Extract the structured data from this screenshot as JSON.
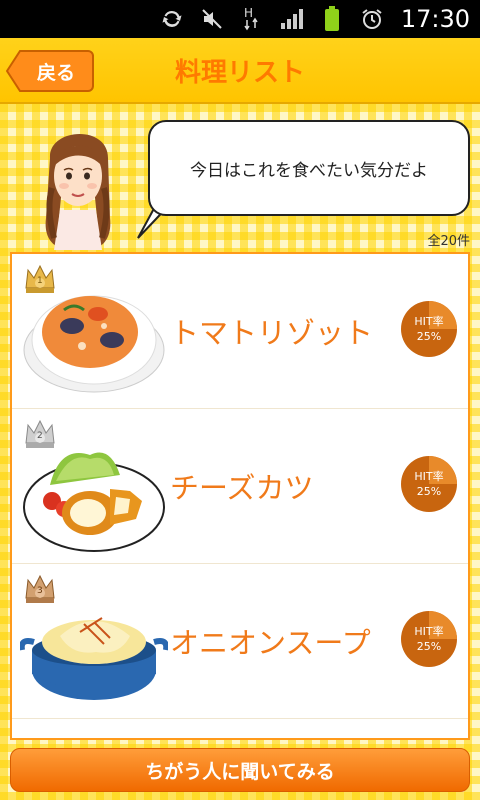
{
  "status": {
    "time": "17:30"
  },
  "header": {
    "back_label": "戻る",
    "title": "料理リスト"
  },
  "speech": {
    "text": "今日はこれを食べたい気分だよ"
  },
  "list_count": "全20件",
  "hit_label": "HIT率",
  "items": [
    {
      "rank": "1",
      "name": "トマトリゾット",
      "hit_rate": "25%",
      "hit_fraction": 0.25,
      "crown_color": "#d9a73a"
    },
    {
      "rank": "2",
      "name": "チーズカツ",
      "hit_rate": "25%",
      "hit_fraction": 0.25,
      "crown_color": "#b8b8b8"
    },
    {
      "rank": "3",
      "name": "オニオンスープ",
      "hit_rate": "25%",
      "hit_fraction": 0.25,
      "crown_color": "#c9955a"
    }
  ],
  "footer": {
    "ask_label": "ちがう人に聞いてみる"
  },
  "colors": {
    "accent": "#f07a1a",
    "header": "#ffc400",
    "hit_dark": "#c8650f",
    "hit_light": "#e88a2a"
  }
}
